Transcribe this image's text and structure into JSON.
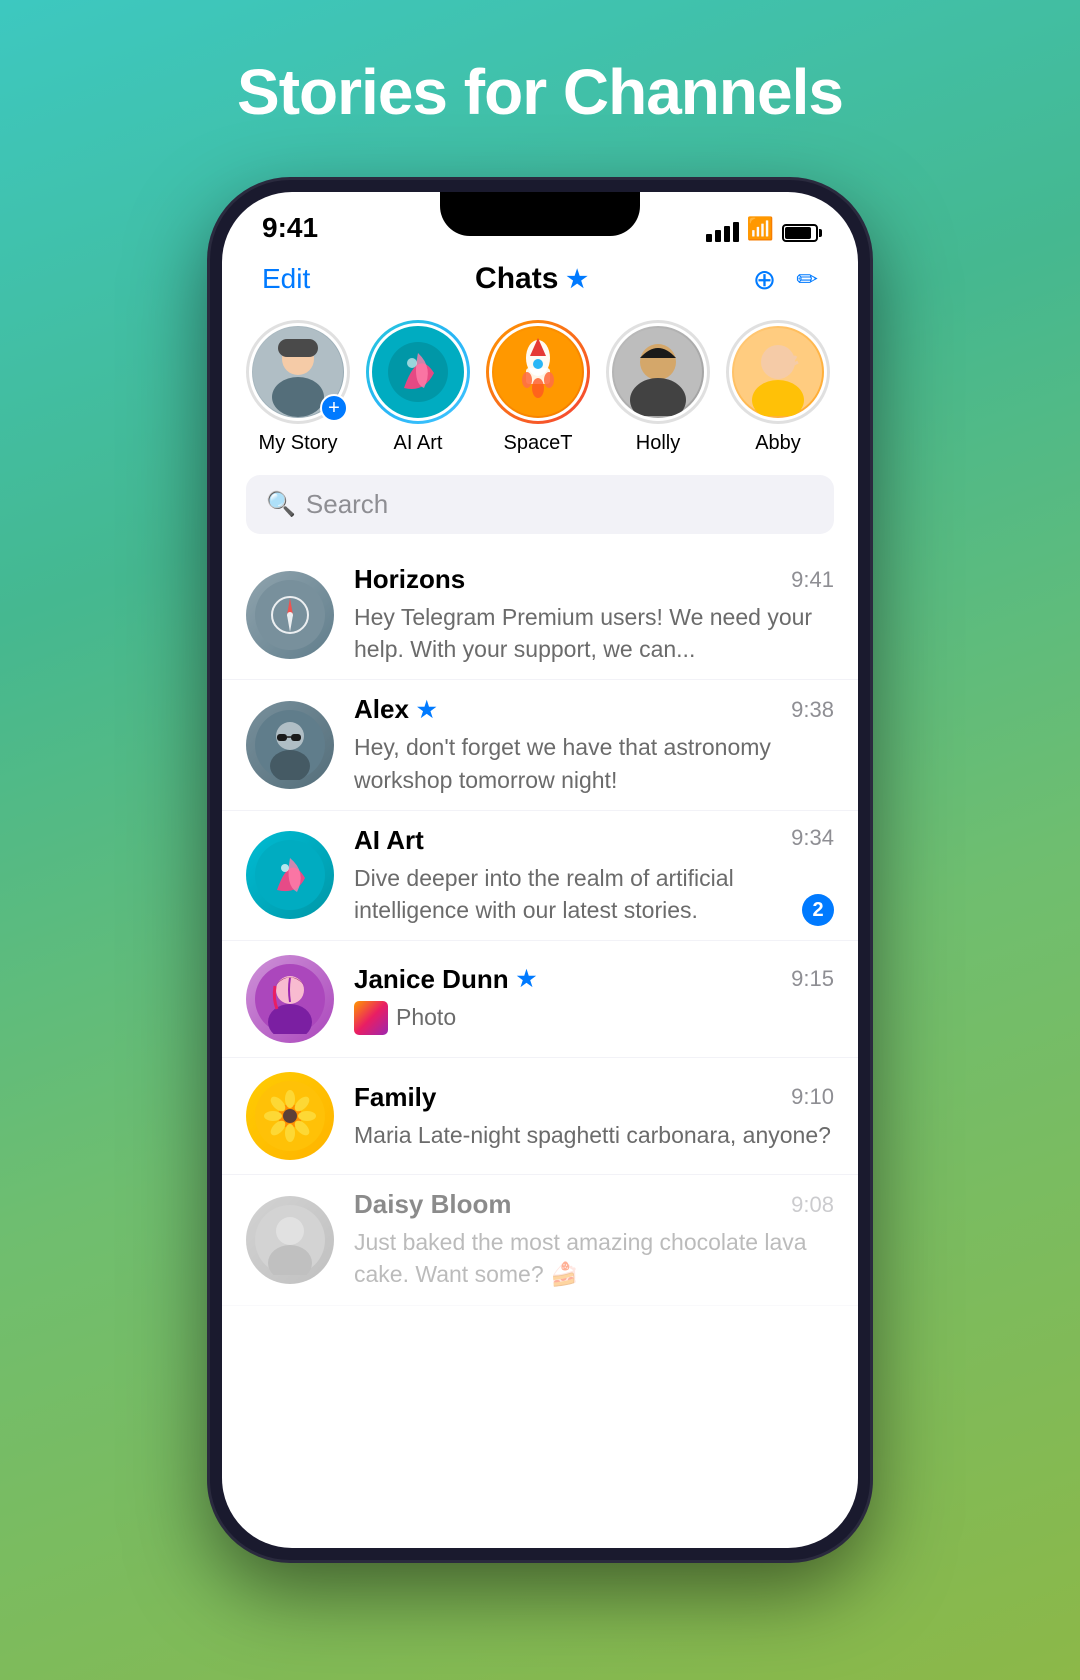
{
  "page": {
    "title": "Stories for Channels",
    "background_gradient": "teal-to-green"
  },
  "phone": {
    "status_bar": {
      "time": "9:41",
      "signal_bars": 4,
      "wifi": true,
      "battery": 80
    },
    "nav": {
      "edit_label": "Edit",
      "title": "Chats",
      "star": "★"
    },
    "stories": [
      {
        "id": "my-story",
        "label": "My Story",
        "has_add": true,
        "ring": "none"
      },
      {
        "id": "ai-art",
        "label": "AI Art",
        "ring": "blue"
      },
      {
        "id": "spacet",
        "label": "SpaceT",
        "ring": "orange"
      },
      {
        "id": "holly",
        "label": "Holly",
        "ring": "gray"
      },
      {
        "id": "abby",
        "label": "Abby",
        "ring": "gray"
      }
    ],
    "search": {
      "placeholder": "Search"
    },
    "chats": [
      {
        "id": "horizons",
        "name": "Horizons",
        "time": "9:41",
        "preview": "Hey Telegram Premium users!  We need your help. With your support, we can...",
        "starred": false,
        "badge": null
      },
      {
        "id": "alex",
        "name": "Alex",
        "time": "9:38",
        "preview": "Hey, don't forget we have that astronomy workshop tomorrow night!",
        "starred": true,
        "badge": null
      },
      {
        "id": "ai-art",
        "name": "AI Art",
        "time": "9:34",
        "preview": "Dive deeper into the realm of artificial intelligence with our latest stories.",
        "starred": false,
        "badge": "2"
      },
      {
        "id": "janice-dunn",
        "name": "Janice Dunn",
        "time": "9:15",
        "preview_type": "photo",
        "preview": "Photo",
        "starred": true,
        "badge": null
      },
      {
        "id": "family",
        "name": "Family",
        "time": "9:10",
        "sender": "Maria",
        "preview": "Late-night spaghetti carbonara, anyone?",
        "starred": false,
        "badge": null
      },
      {
        "id": "daisy-bloom",
        "name": "Daisy Bloom",
        "time": "9:08",
        "preview": "Just baked the most amazing chocolate lava cake. Want some? 🍰",
        "starred": false,
        "badge": null,
        "faded": true
      }
    ]
  }
}
